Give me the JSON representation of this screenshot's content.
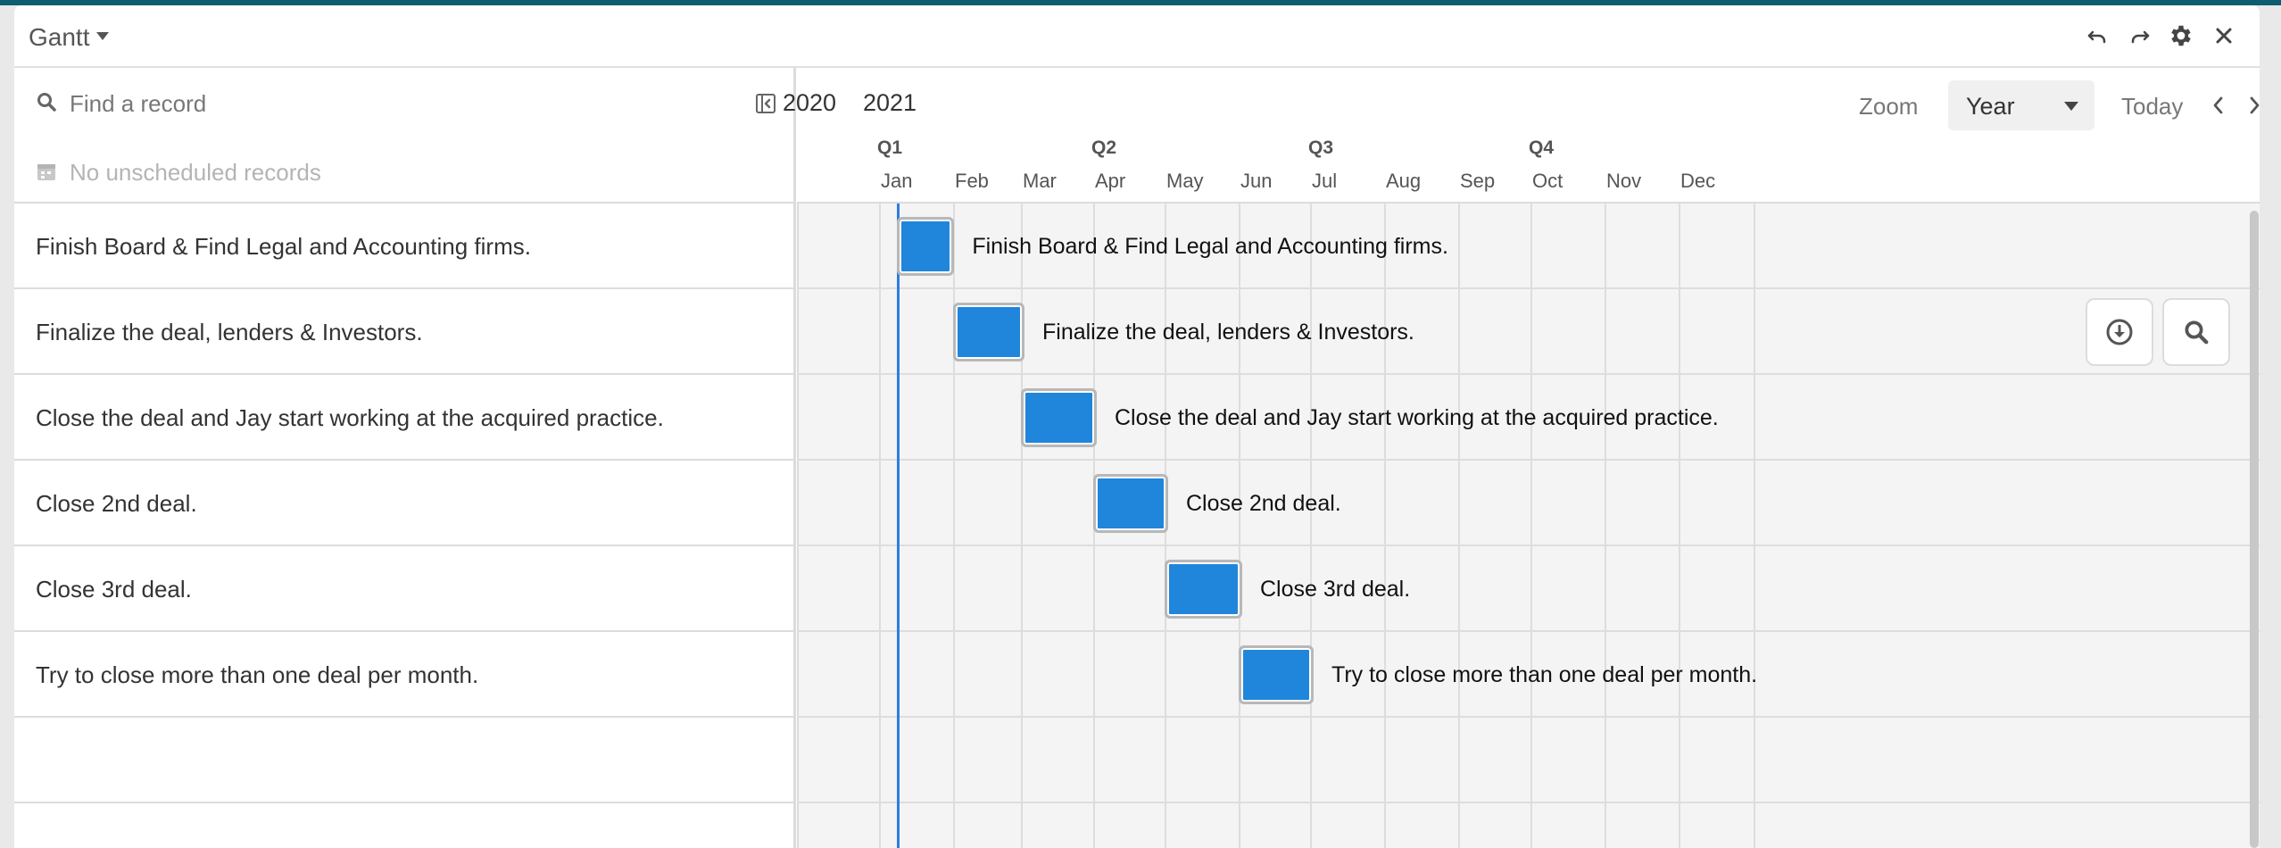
{
  "app": {
    "title": "Gantt"
  },
  "icons": {
    "dropdown": "caret-down-icon",
    "undo": "undo-icon",
    "redo": "redo-icon",
    "settings": "gear-icon",
    "close": "close-icon",
    "search": "search-icon",
    "collapse": "collapse-panel-icon",
    "calendar": "calendar-icon",
    "download": "download-icon",
    "zoom_search": "search-icon",
    "prev": "chevron-left-icon",
    "next": "chevron-right-icon"
  },
  "left_panel": {
    "search_placeholder": "Find a record",
    "unscheduled_text": "No unscheduled records",
    "records": [
      "Finish Board & Find Legal and Accounting firms.",
      "Finalize the deal, lenders & Investors.",
      "Close the deal and Jay start working at the acquired practice.",
      "Close 2nd deal.",
      "Close 3rd deal.",
      "Try to close more than one deal per month."
    ]
  },
  "timeline": {
    "years": [
      "2020",
      "2021"
    ],
    "quarters": [
      "Q1",
      "Q2",
      "Q3",
      "Q4"
    ],
    "months": [
      "Jan",
      "Feb",
      "Mar",
      "Apr",
      "May",
      "Jun",
      "Jul",
      "Aug",
      "Sep",
      "Oct",
      "Nov",
      "Dec"
    ],
    "zoom_label": "Zoom",
    "zoom_value": "Year",
    "today_label": "Today",
    "tasks": [
      {
        "label": "Finish Board & Find Legal and Accounting firms.",
        "start": "2021-01-01",
        "end": "2021-01-31"
      },
      {
        "label": "Finalize the deal, lenders & Investors.",
        "start": "2021-02-01",
        "end": "2021-03-01"
      },
      {
        "label": "Close the deal and Jay start working at the acquired practice.",
        "start": "2021-03-01",
        "end": "2021-04-01"
      },
      {
        "label": "Close 2nd deal.",
        "start": "2021-04-01",
        "end": "2021-05-01"
      },
      {
        "label": "Close 3rd deal.",
        "start": "2021-05-01",
        "end": "2021-06-01"
      },
      {
        "label": "Try to close more than one deal per month.",
        "start": "2021-06-01",
        "end": "2021-07-01"
      }
    ]
  },
  "colors": {
    "bar": "#1f86dc",
    "today_line": "#2d7ee0",
    "brand": "#0e5c72"
  }
}
